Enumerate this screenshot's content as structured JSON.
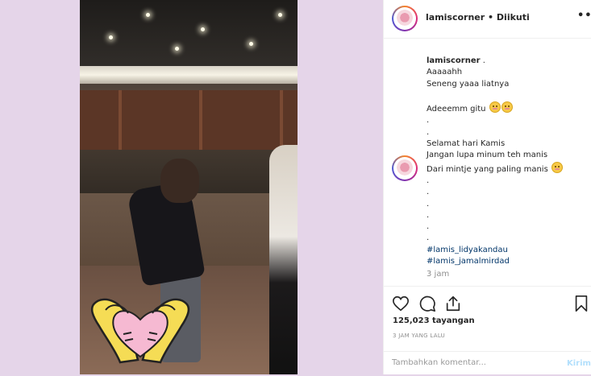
{
  "post": {
    "header": {
      "username": "lamiscorner",
      "separator": "•",
      "follow_status": "Diikuti",
      "more_icon": "more-horizontal-icon"
    },
    "caption": {
      "username": "lamiscorner",
      "lines": [
        ".",
        "Aaaaahh",
        "Seneng yaaa liatnya",
        "",
        "Adeeemm gitu",
        ".",
        ".",
        "Selamat hari Kamis",
        "Jangan lupa minum teh manis",
        "Dari mintje yang paling manis",
        ".",
        ".",
        ".",
        ".",
        ".",
        ".",
        "#lamis_lidyakandau",
        "#lamis_jamalmirdad"
      ],
      "time": "3 jam"
    },
    "actions": {
      "like_icon": "heart-icon",
      "comment_icon": "comment-icon",
      "share_icon": "share-icon",
      "save_icon": "bookmark-icon"
    },
    "views": "125,023 tayangan",
    "posted_ago": "3 JAM YANG LALU",
    "comment": {
      "placeholder": "Tambahkan komentar...",
      "value": "",
      "send_label": "Kirim"
    }
  },
  "colors": {
    "background": "#e5d5e9",
    "hashtag": "#003569",
    "send_disabled": "#b2dffc",
    "muted": "#8e8e8e"
  }
}
